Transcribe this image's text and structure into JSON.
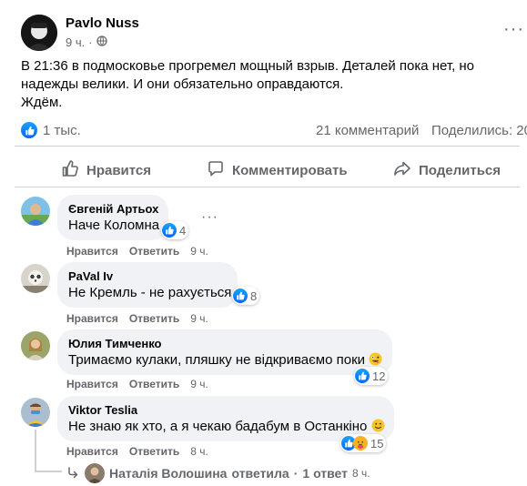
{
  "post": {
    "author": "Pavlo Nuss",
    "time": "9 ч.",
    "privacy_icon": "globe-icon",
    "text_lines": [
      "В 21:36 в подмосковье прогремел мощный взрыв. Деталей пока нет, но",
      "надежды велики. И они обязательно оправдаются.",
      "Ждём."
    ],
    "reactions_count": "1 тыс.",
    "comments_count": "21 комментарий",
    "shares_count": "Поделились: 20"
  },
  "actions": {
    "like": "Нравится",
    "comment": "Комментировать",
    "share": "Поделиться"
  },
  "comment_actions": {
    "like": "Нравится",
    "reply": "Ответить"
  },
  "comments": [
    {
      "author": "Євгеній Артьох",
      "text": "Наче Коломна",
      "reactions": "4",
      "time": "9 ч."
    },
    {
      "author": "PaVal Iv",
      "text": "Не Кремль - не рахується.",
      "reactions": "8",
      "time": "9 ч."
    },
    {
      "author": "Юлия Тимченко",
      "text": "Тримаємо кулаки, пляшку не відкриваємо поки",
      "reactions": "12",
      "time": "9 ч."
    },
    {
      "author": "Viktor Teslia",
      "text": "Не знаю як хто, а я чекаю бадабум в Останкіно",
      "reactions": "15",
      "time": "8 ч."
    }
  ],
  "reply_summary": {
    "name": "Наталія Волошина",
    "action": "ответила",
    "separator": "·",
    "count": "1 ответ",
    "time": "8 ч."
  },
  "colors": {
    "like_blue": "#0866ff",
    "muted": "#65676b",
    "bubble": "#f0f2f5"
  }
}
